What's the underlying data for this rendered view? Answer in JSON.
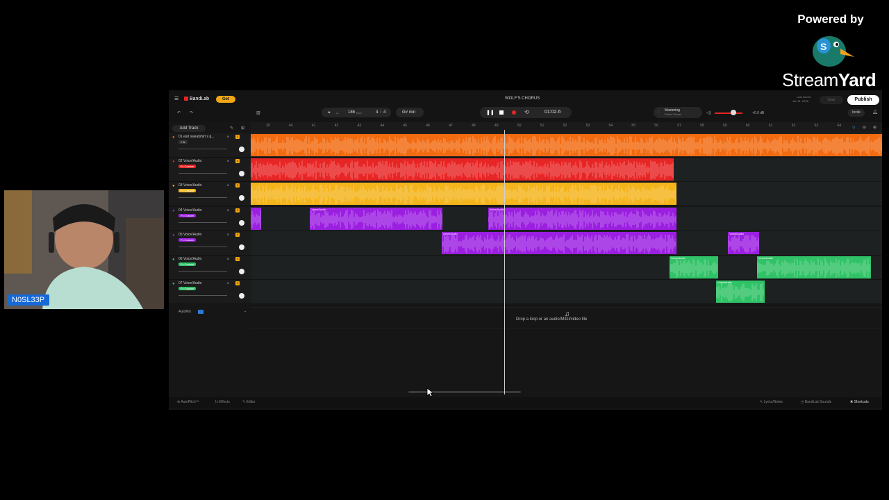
{
  "overlay": {
    "powered_by": "Powered by",
    "brand_a": "Stream",
    "brand_b": "Yard",
    "webcam_name": "N0SL33P"
  },
  "daw": {
    "app_name": "BandLab",
    "get_label": "Get",
    "project_title": "WOLF'S CHORUS",
    "tempo": "186",
    "tempo_unit": "bpm",
    "time_sig_num": "4",
    "time_sig_den": "4",
    "key": "G# min",
    "time_display": "01:02.6",
    "mastering_label": "Mastering",
    "mastering_sub": "Select Preset",
    "volume_db": "+0.0 dB",
    "last_saved_label": "Last Saved",
    "last_saved_date": "Jan 11, 2026",
    "save_label": "Save",
    "publish_label": "Publish",
    "invite_label": "Invite",
    "add_track": "Add Track",
    "ruler_ticks": [
      "39",
      "40",
      "41",
      "42",
      "43",
      "44",
      "45",
      "46",
      "47",
      "48",
      "49",
      "50",
      "51",
      "52",
      "53",
      "54",
      "55",
      "56",
      "57",
      "58",
      "59",
      "60",
      "61",
      "62",
      "63",
      "64"
    ],
    "automix_label": "AutoMix",
    "drop_hint": "Drop a loop or an audio/MIDI/video file",
    "bottom_left": [
      "AutoPitch™",
      "Effects",
      "Editor"
    ],
    "bottom_right": [
      "Lyrics/Notes",
      "BandLab Sounds",
      "Shortcuts"
    ]
  },
  "tracks": [
    {
      "name": "01  earl sweatshirt x g...",
      "preset": "+ fx",
      "color": "#f26b10",
      "preset_color": "#333333"
    },
    {
      "name": "02  Voice/Audio",
      "preset": "Fx Custom",
      "color": "#e82525",
      "preset_color": "#e82525"
    },
    {
      "name": "03  Voice/Audio",
      "preset": "Fx Custom",
      "color": "#f4b41b",
      "preset_color": "#f4b41b"
    },
    {
      "name": "04  Voice/Audio",
      "preset": "Fx Custom",
      "color": "#9b1fe0",
      "preset_color": "#9b1fe0"
    },
    {
      "name": "05  Voice/Audio",
      "preset": "Fx Custom",
      "color": "#9b1fe0",
      "preset_color": "#9b1fe0"
    },
    {
      "name": "06  Voice/Audio",
      "preset": "Fx Custom",
      "color": "#2fc266",
      "preset_color": "#2fc266"
    },
    {
      "name": "07  Voice/Audio",
      "preset": "Fx Custom",
      "color": "#2fc266",
      "preset_color": "#2fc266"
    }
  ],
  "clips": [
    {
      "track": 0,
      "start": 0.0,
      "end": 1.0,
      "label": ""
    },
    {
      "track": 1,
      "start": 0.0,
      "end": 0.67,
      "label": ""
    },
    {
      "track": 2,
      "start": 0.0,
      "end": 0.674,
      "label": ""
    },
    {
      "track": 3,
      "start": 0.0,
      "end": 0.016,
      "label": ""
    },
    {
      "track": 3,
      "start": 0.094,
      "end": 0.304,
      "label": "Voice/Audio"
    },
    {
      "track": 3,
      "start": 0.376,
      "end": 0.674,
      "label": "Voice/Audio"
    },
    {
      "track": 4,
      "start": 0.302,
      "end": 0.674,
      "label": "Voice/Audio"
    },
    {
      "track": 4,
      "start": 0.756,
      "end": 0.805,
      "label": "Voice/Audio"
    },
    {
      "track": 5,
      "start": 0.663,
      "end": 0.74,
      "label": "Voice/Audio"
    },
    {
      "track": 5,
      "start": 0.802,
      "end": 0.982,
      "label": "Voice/Audio"
    },
    {
      "track": 6,
      "start": 0.737,
      "end": 0.814,
      "label": "Voice/Audio"
    }
  ]
}
